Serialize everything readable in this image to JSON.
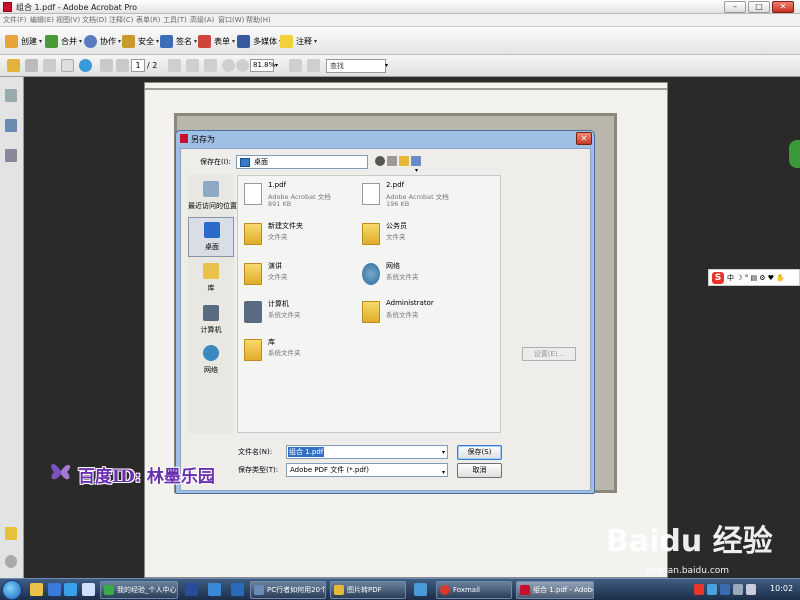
{
  "window": {
    "title": "组合 1.pdf - Adobe Acrobat Pro",
    "min": "–",
    "max": "□",
    "close": "✕"
  },
  "menu": [
    "文件(F)",
    "编辑(E)",
    "视图(V)",
    "文档(D)",
    "注释(C)",
    "表单(R)",
    "工具(T)",
    "高级(A)",
    "窗口(W)",
    "帮助(H)"
  ],
  "toolbar1": {
    "create": "创建",
    "combine": "合并",
    "collaborate": "协作",
    "secure": "安全",
    "sign": "签名",
    "forms": "表单",
    "multimedia": "多媒体",
    "comment": "注释",
    "dropdown": "▾"
  },
  "toolbar2": {
    "page_current": "1",
    "page_total": "/ 2",
    "zoom": "81.8%",
    "find": "查找",
    "dropdown": "▾"
  },
  "dialog": {
    "title": "另存为",
    "close": "✕",
    "save_in_label": "保存在(I):",
    "save_in_value": "桌面",
    "dropdown": "▾",
    "places": [
      "最近访问的位置",
      "桌面",
      "库",
      "计算机",
      "网络"
    ],
    "files": [
      {
        "name": "1.pdf",
        "type": "Adobe Acrobat 文档",
        "size": "891 KB",
        "icon": "pdf-file-icon"
      },
      {
        "name": "2.pdf",
        "type": "Adobe Acrobat 文档",
        "size": "196 KB",
        "icon": "pdf-file-icon"
      },
      {
        "name": "新建文件夹",
        "type": "文件夹",
        "size": "",
        "icon": "folder-icon"
      },
      {
        "name": "公务员",
        "type": "文件夹",
        "size": "",
        "icon": "folder-icon"
      },
      {
        "name": "演讲",
        "type": "文件夹",
        "size": "",
        "icon": "folder-icon"
      },
      {
        "name": "网络",
        "type": "系统文件夹",
        "size": "",
        "icon": "network-icon"
      },
      {
        "name": "计算机",
        "type": "系统文件夹",
        "size": "",
        "icon": "computer-icon"
      },
      {
        "name": "Administrator",
        "type": "系统文件夹",
        "size": "",
        "icon": "user-folder-icon"
      },
      {
        "name": "库",
        "type": "系统文件夹",
        "size": "",
        "icon": "library-icon"
      }
    ],
    "settings_button": "设置(E)...",
    "filename_label": "文件名(N):",
    "filename_value": "组合 1.pdf",
    "filetype_label": "保存类型(T):",
    "filetype_value": "Adobe PDF 文件 (*.pdf)",
    "save_button": "保存(S)",
    "cancel_button": "取消"
  },
  "ime": {
    "logo": "S",
    "items": "中 ☽ ° ▤ ⚙ ♥ ✋"
  },
  "watermark": {
    "text": "百度ID: 林墨乐园",
    "baidu": "Baidu 经验",
    "url": "jingyan.baidu.com"
  },
  "taskbar": {
    "items": [
      "我的经验_个人中心...",
      "PC行者如何用20个...",
      "图片转PDF",
      "Foxmail",
      "组合 1.pdf - Adobe..."
    ],
    "time": "10:02"
  },
  "colors": {
    "acrobat_red": "#c8102e",
    "dialog_frame": "#9fc0e4",
    "taskbar": "#1c2e49",
    "selection": "#3170c8"
  }
}
